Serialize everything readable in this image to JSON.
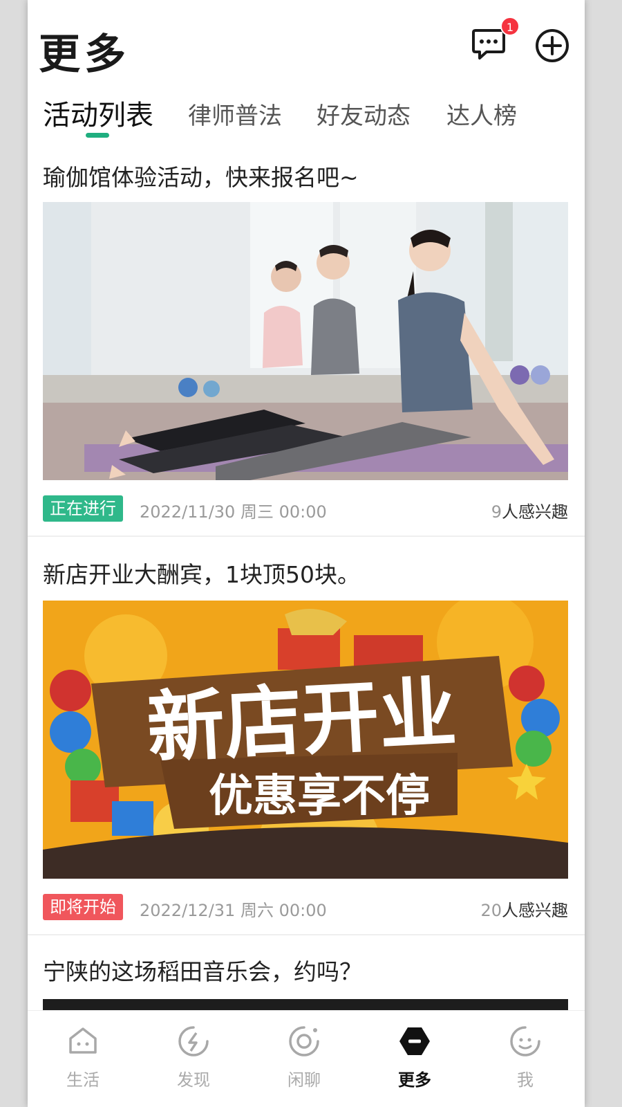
{
  "header": {
    "title": "更多",
    "message_badge_count": "1",
    "icons": {
      "messages": "chat-bubble-icon",
      "add": "plus-circle-icon"
    }
  },
  "tabs": [
    {
      "label": "活动列表",
      "active": true
    },
    {
      "label": "律师普法",
      "active": false
    },
    {
      "label": "好友动态",
      "active": false
    },
    {
      "label": "达人榜",
      "active": false
    }
  ],
  "feed": [
    {
      "title": "瑜伽馆体验活动，快来报名吧~",
      "image": "yoga-class-photo",
      "status": "正在进行",
      "status_color": "#2fb88a",
      "date": "2022/11/30 周三 00:00",
      "interest_count": "9",
      "interest_suffix": "人感兴趣"
    },
    {
      "title": "新店开业大酬宾，1块顶50块。",
      "image": "new-store-opening-banner",
      "banner_headline": "新店开业",
      "banner_subline": "优惠享不停",
      "status": "即将开始",
      "status_color": "#f0565c",
      "date": "2022/12/31 周六 00:00",
      "interest_count": "20",
      "interest_suffix": "人感兴趣"
    },
    {
      "title": "宁陕的这场稻田音乐会，约吗？"
    }
  ],
  "bottom_nav": [
    {
      "label": "生活",
      "icon": "life-icon",
      "active": false
    },
    {
      "label": "发现",
      "icon": "discover-icon",
      "active": false
    },
    {
      "label": "闲聊",
      "icon": "chat-icon",
      "active": false
    },
    {
      "label": "更多",
      "icon": "more-icon",
      "active": true
    },
    {
      "label": "我",
      "icon": "me-icon",
      "active": false
    }
  ],
  "colors": {
    "accent": "#1fae7f",
    "badge_red": "#f5333f",
    "ongoing": "#2fb88a",
    "upcoming": "#f0565c"
  }
}
